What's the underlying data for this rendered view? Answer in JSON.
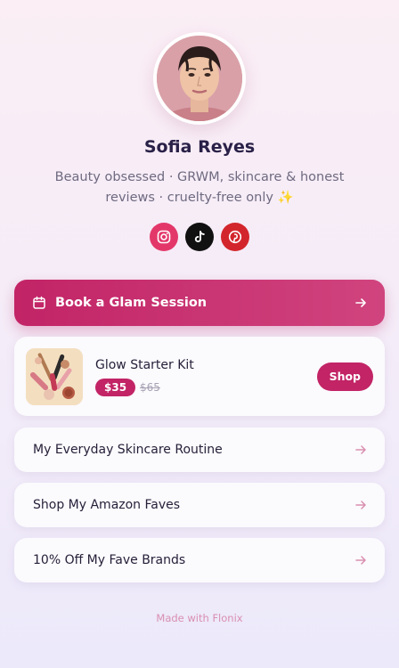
{
  "profile": {
    "name": "Sofia Reyes",
    "bio_line1": "Beauty obsessed · GRWM, skincare & honest",
    "bio_line2": "reviews · cruelty-free only ✨"
  },
  "socials": [
    {
      "name": "instagram",
      "icon": "instagram-icon",
      "color": "#e3376a"
    },
    {
      "name": "tiktok",
      "icon": "tiktok-icon",
      "color": "#111111"
    },
    {
      "name": "pinterest",
      "icon": "pinterest-icon",
      "color": "#d3262c"
    }
  ],
  "cta": {
    "label": "Book a Glam Session",
    "icon": "calendar-icon"
  },
  "product": {
    "title": "Glow Starter Kit",
    "price": "$35",
    "old_price": "$65",
    "button": "Shop"
  },
  "links": [
    {
      "label": "My Everyday Skincare Routine"
    },
    {
      "label": "Shop My Amazon Faves"
    },
    {
      "label": "10% Off My Fave Brands"
    }
  ],
  "footer": "Made with Flonix",
  "colors": {
    "accent": "#c22466",
    "footer": "#d98fb0"
  }
}
